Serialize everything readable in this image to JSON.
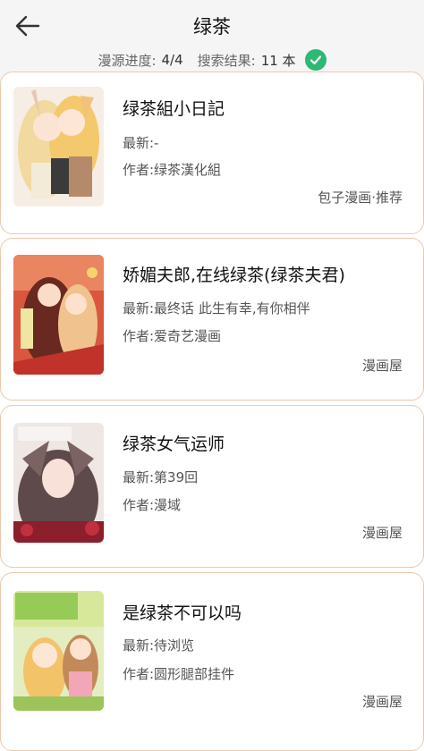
{
  "header": {
    "title": "绿茶",
    "progress_label": "漫源进度:",
    "progress_value": "4/4",
    "result_label": "搜索结果:",
    "result_value": "11 本"
  },
  "colors": {
    "accent_check": "#2eb872",
    "card_border": "#ecc9ae",
    "header_bg": "#f5f5f5"
  },
  "results": [
    {
      "title": "绿茶組小日記",
      "latest": "最新:-",
      "author": "作者:绿茶漢化組",
      "source": "包子漫画·推荐"
    },
    {
      "title": "娇媚夫郎,在线绿茶(绿茶夫君)",
      "latest": "最新:最终话 此生有幸,有你相伴",
      "author": "作者:爱奇艺漫画",
      "source": "漫画屋"
    },
    {
      "title": "绿茶女气运师",
      "latest": "最新:第39回",
      "author": "作者:漫域",
      "source": "漫画屋"
    },
    {
      "title": "是绿茶不可以吗",
      "latest": "最新:待浏览",
      "author": "作者:圆形腿部挂件",
      "source": "漫画屋"
    }
  ],
  "cover_icons": [
    "cover-image-1",
    "cover-image-2",
    "cover-image-3",
    "cover-image-4"
  ]
}
